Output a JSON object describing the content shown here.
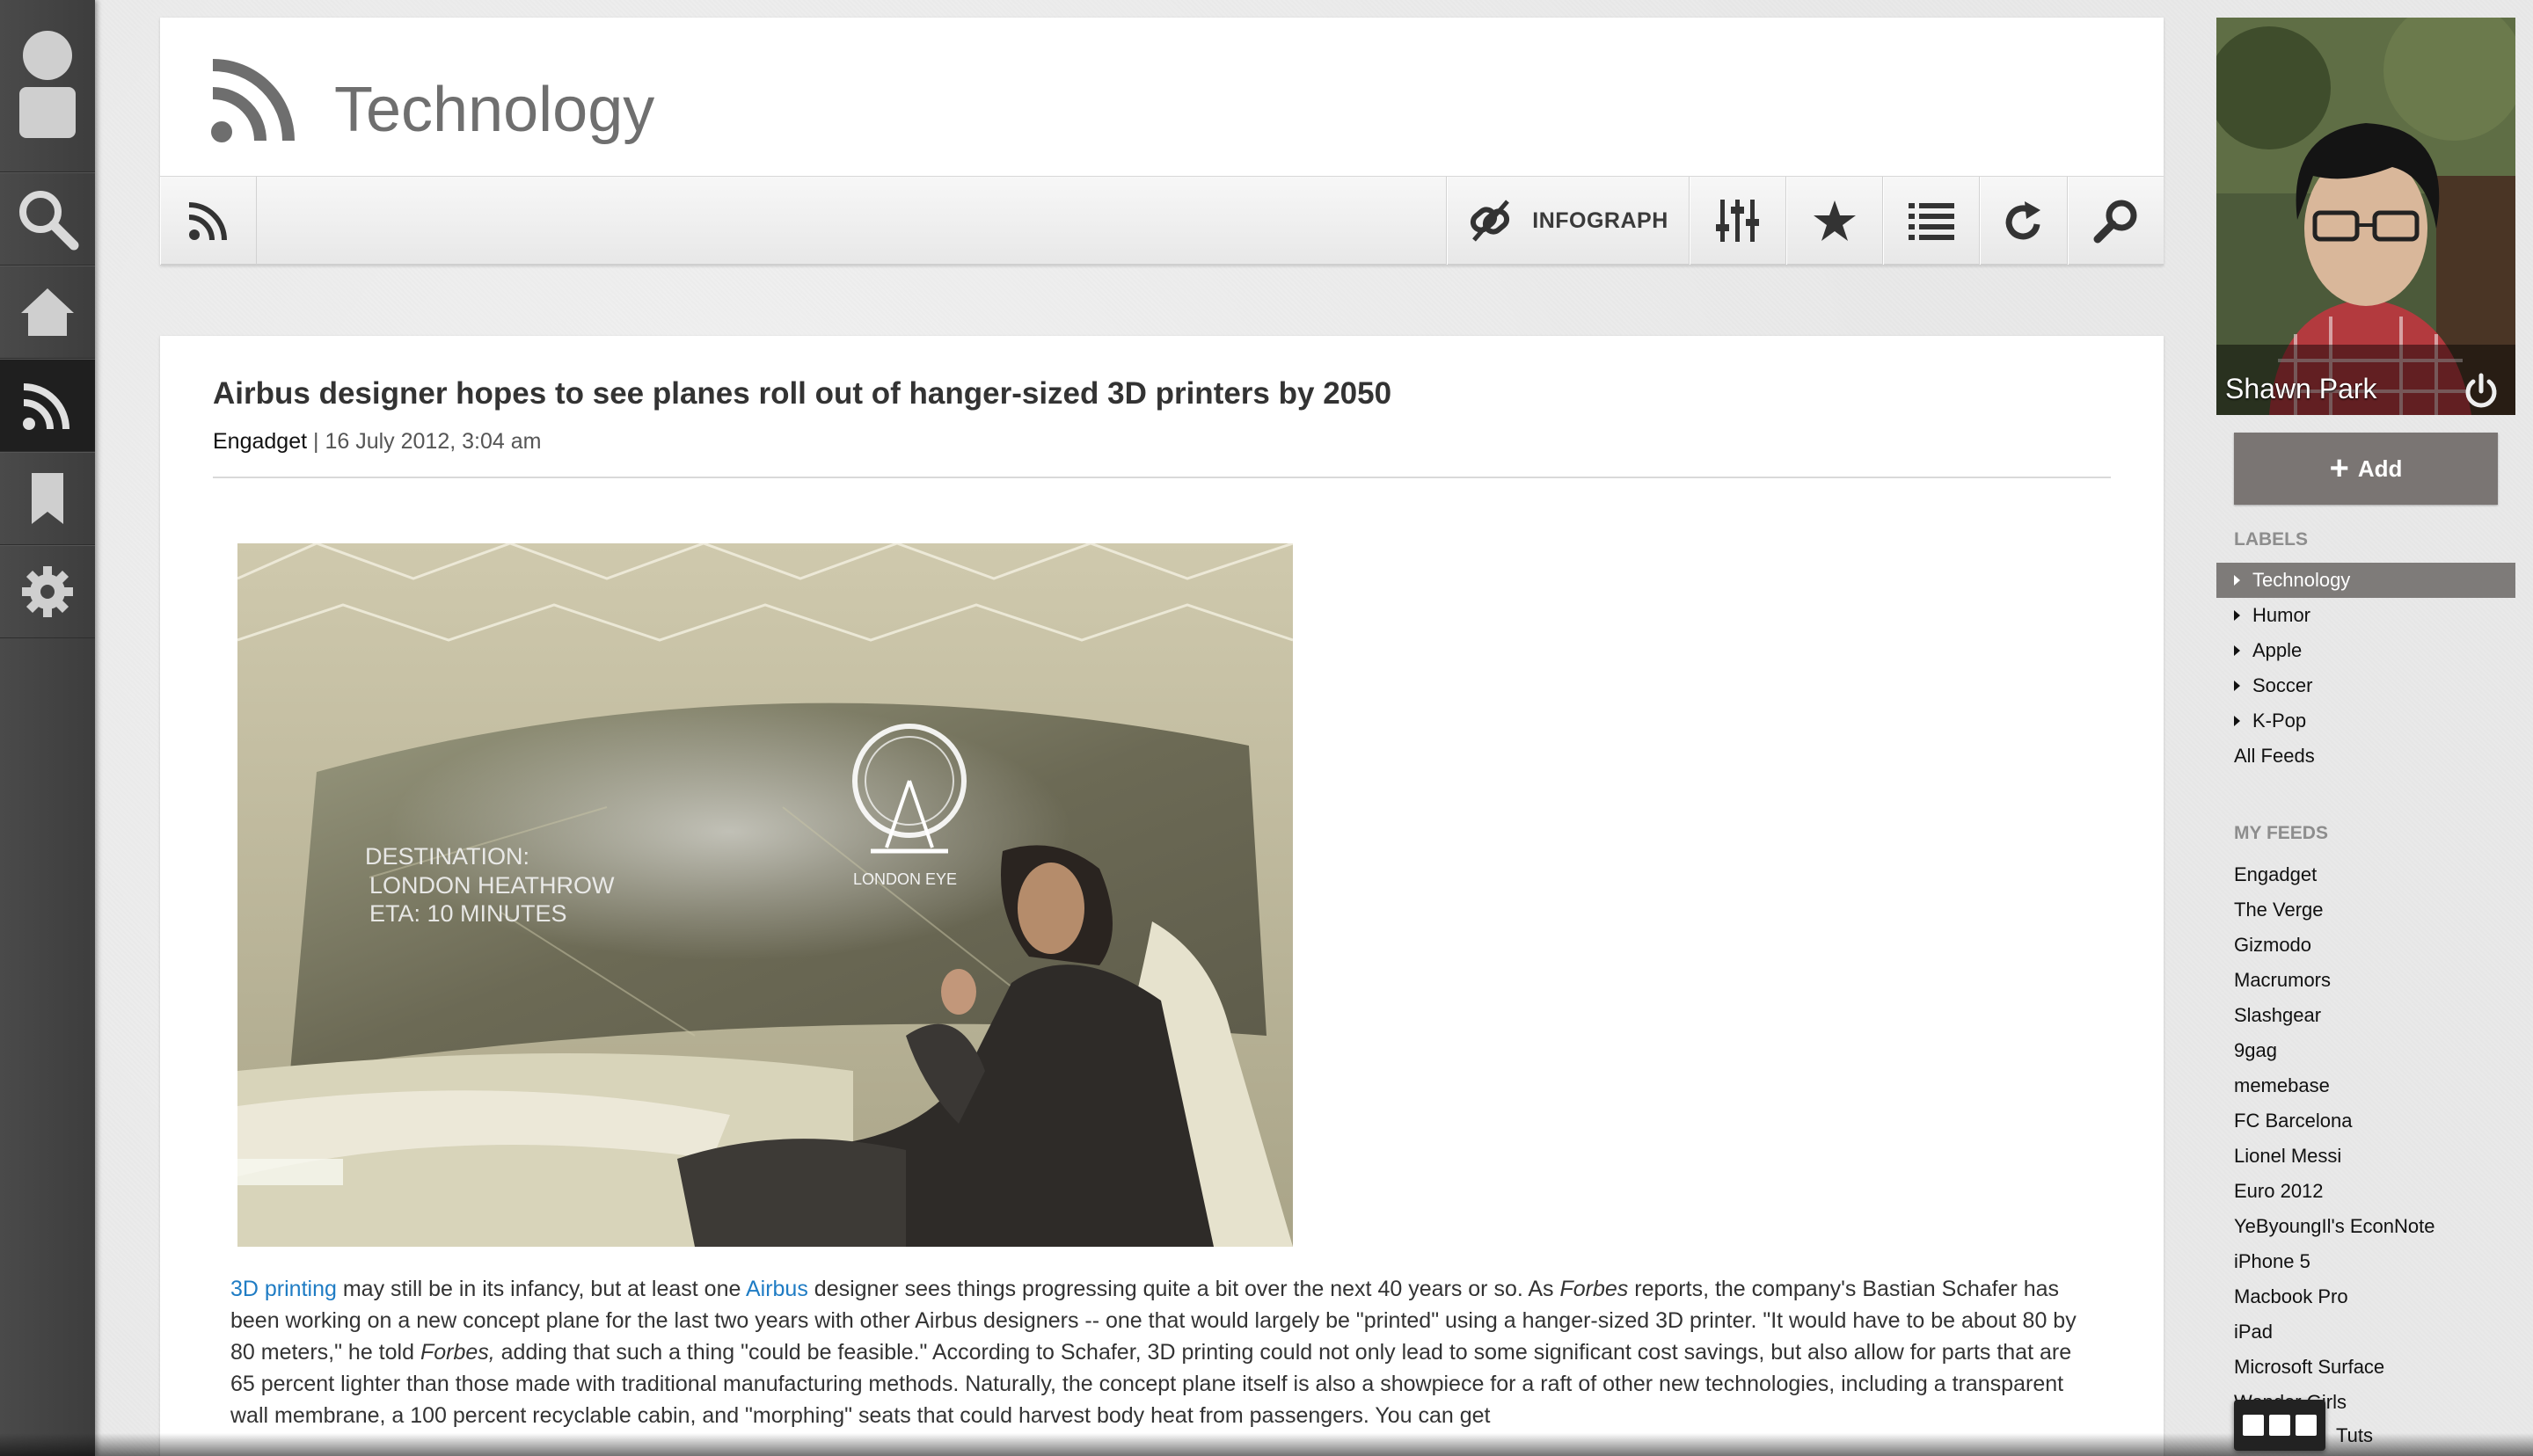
{
  "header": {
    "title": "Technology",
    "toolbar": {
      "infograph_label": "INFOGRAPH"
    }
  },
  "article": {
    "title": "Airbus designer hopes to see planes roll out of hanger-sized 3D printers by 2050",
    "source": "Engadget",
    "date": "16 July 2012, 3:04 am",
    "image_overlay": {
      "destination_line1": "DESTINATION:",
      "destination_line2": "LONDON HEATHROW",
      "eta": "ETA: 10 MINUTES",
      "landmark": "LONDON EYE"
    },
    "body": {
      "link1": "3D printing",
      "text1": " may still be in its infancy, but at least one ",
      "link2": "Airbus",
      "text2": " designer sees things progressing quite a bit over the next 40 years or so. As ",
      "em1": "Forbes",
      "text3": " reports, the company's Bastian Schafer has been working on a new concept plane for the last two years with other Airbus designers -- one that would largely be \"printed\" using a hanger-sized 3D printer. \"It would have to be about 80 by 80 meters,\" he told ",
      "em2": "Forbes,",
      "text4": " adding that such a thing \"could be feasible.\" According to Schafer, 3D printing could not only lead to some significant cost savings, but also allow for parts that are 65 percent lighter than those made with traditional manufacturing methods. Naturally, the concept plane itself is also a showpiece for a raft of other new technologies, including a transparent wall membrane, a 100 percent recyclable cabin, and \"morphing\" seats that could harvest body heat from passengers. You can get"
    }
  },
  "profile": {
    "name": "Shawn Park"
  },
  "sidebar": {
    "add_label": "Add",
    "labels_heading": "LABELS",
    "labels": [
      "Technology",
      "Humor",
      "Apple",
      "Soccer",
      "K-Pop"
    ],
    "all_feeds": "All Feeds",
    "feeds_heading": "MY FEEDS",
    "feeds": [
      "Engadget",
      "The Verge",
      "Gizmodo",
      "Macrumors",
      "Slashgear",
      "9gag",
      "memebase",
      "FC Barcelona",
      "Lionel Messi",
      "Euro 2012",
      "YeByoungIl's EconNote",
      "iPhone 5",
      "Macbook Pro",
      "iPad",
      "Microsoft Surface",
      "Wonder Girls",
      "Tuts"
    ]
  },
  "colors": {
    "accent_link": "#1f7cc4",
    "active_label_bg": "#7e7b79",
    "rail_bg": "#444444"
  }
}
